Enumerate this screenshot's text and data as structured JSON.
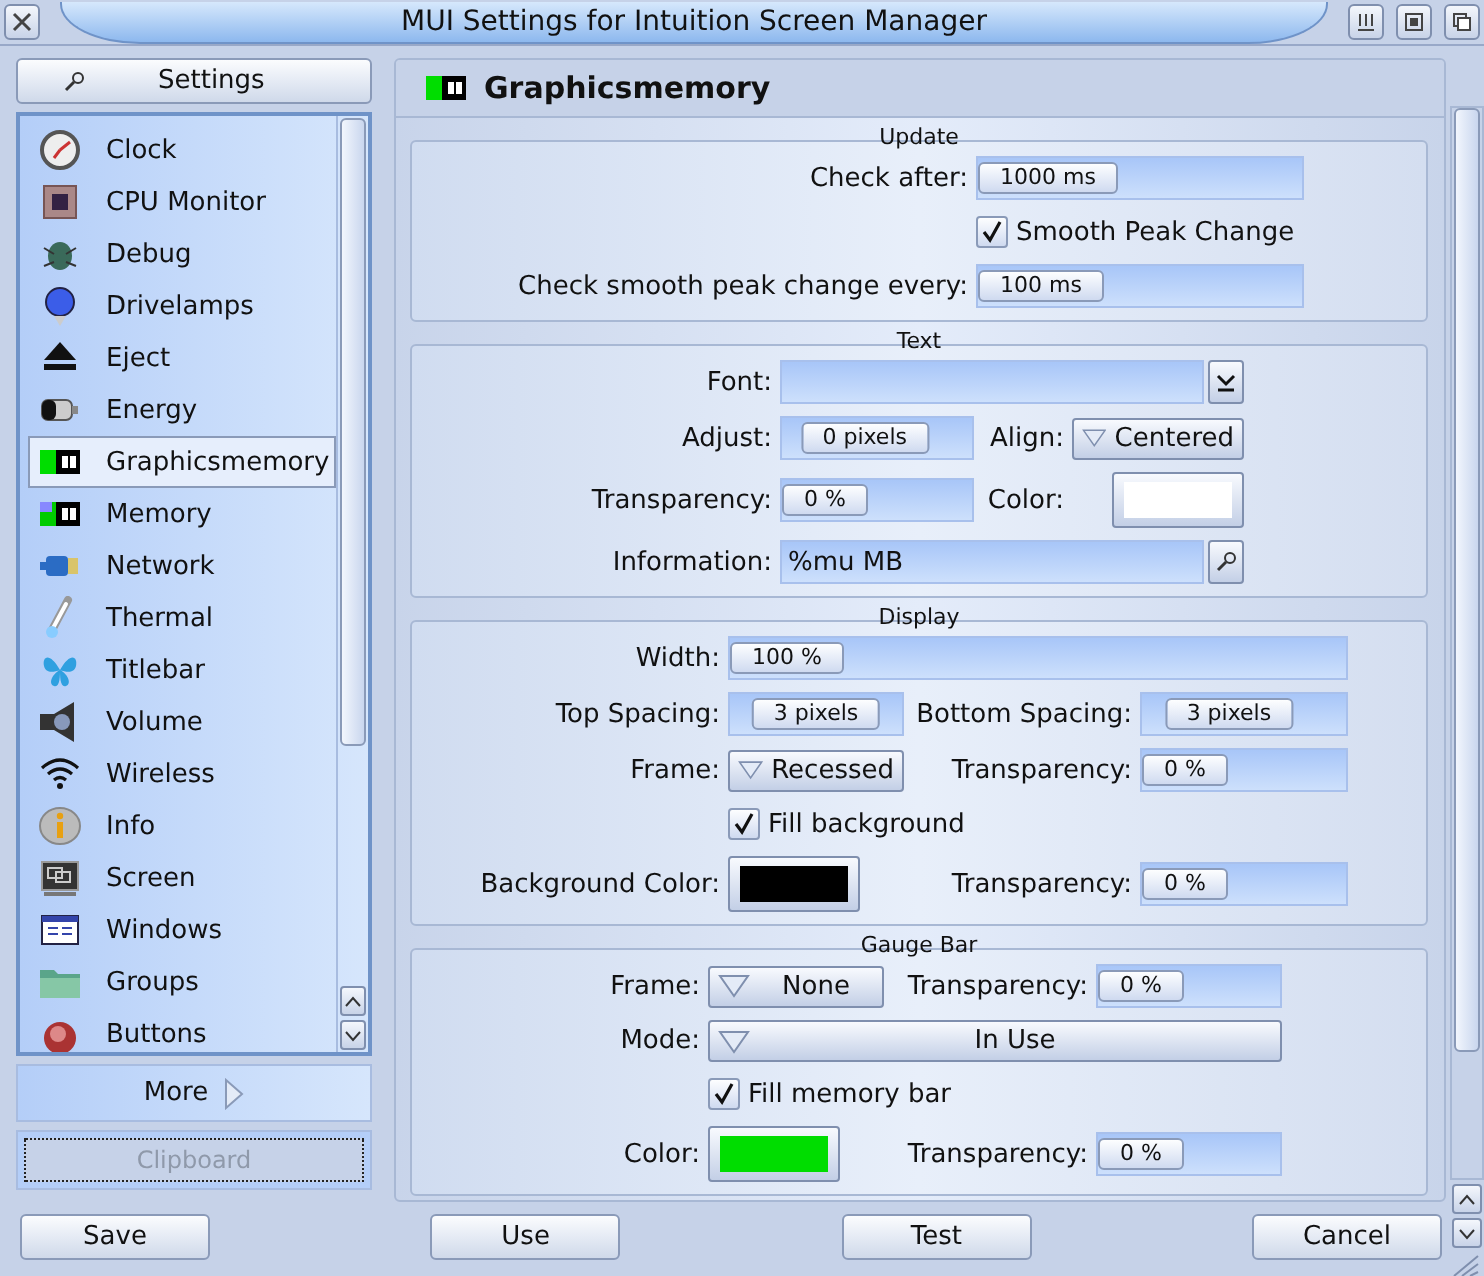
{
  "window": {
    "title": "MUI Settings for Intuition Screen Manager"
  },
  "sidebar": {
    "settings_button": "Settings",
    "items": [
      {
        "label": "Clock",
        "selected": false
      },
      {
        "label": "CPU Monitor",
        "selected": false
      },
      {
        "label": "Debug",
        "selected": false
      },
      {
        "label": "Drivelamps",
        "selected": false
      },
      {
        "label": "Eject",
        "selected": false
      },
      {
        "label": "Energy",
        "selected": false
      },
      {
        "label": "Graphicsmemory",
        "selected": true
      },
      {
        "label": "Memory",
        "selected": false
      },
      {
        "label": "Network",
        "selected": false
      },
      {
        "label": "Thermal",
        "selected": false
      },
      {
        "label": "Titlebar",
        "selected": false
      },
      {
        "label": "Volume",
        "selected": false
      },
      {
        "label": "Wireless",
        "selected": false
      },
      {
        "label": "Info",
        "selected": false
      },
      {
        "label": "Screen",
        "selected": false
      },
      {
        "label": "Windows",
        "selected": false
      },
      {
        "label": "Groups",
        "selected": false
      },
      {
        "label": "Buttons",
        "selected": false
      }
    ],
    "more_button": "More",
    "clipboard_button": {
      "label": "Clipboard",
      "disabled": true
    }
  },
  "panel": {
    "title": "Graphicsmemory",
    "groups": [
      {
        "title": "Update",
        "rows": [
          [
            {
              "kind": "slider",
              "label": "Check after:",
              "value": "1000 ms",
              "level": 0
            }
          ],
          [
            {
              "kind": "checkbox",
              "label": "Smooth Peak Change",
              "checked": true
            }
          ],
          [
            {
              "kind": "slider",
              "label": "Check smooth peak change every:",
              "value": "100 ms",
              "level": 0
            }
          ]
        ]
      },
      {
        "title": "Text",
        "rows": [
          [
            {
              "kind": "fontfield",
              "label": "Font:"
            }
          ],
          [
            {
              "kind": "slider",
              "label": "Adjust:",
              "value": "0 pixels",
              "level": 0.3
            },
            {
              "kind": "cycle",
              "label": "Align:",
              "value": "Centered"
            }
          ],
          [
            {
              "kind": "slider",
              "label": "Transparency:",
              "value": "0 %",
              "level": 0
            },
            {
              "kind": "color",
              "label": "Color:",
              "color": "#ffffff"
            }
          ],
          [
            {
              "kind": "searchfield",
              "label": "Information:",
              "value": "%mu MB"
            }
          ]
        ]
      },
      {
        "title": "Display",
        "rows": [
          [
            {
              "kind": "slider",
              "label": "Width:",
              "value": "100 %",
              "level": 0
            }
          ],
          [
            {
              "kind": "slider",
              "label": "Top Spacing:",
              "value": "3 pixels",
              "level": 0.5
            },
            {
              "kind": "slider",
              "label": "Bottom Spacing:",
              "value": "3 pixels",
              "level": 0.3
            }
          ],
          [
            {
              "kind": "cycle",
              "label": "Frame:",
              "value": "Recessed"
            },
            {
              "kind": "slider",
              "label": "Transparency:",
              "value": "0 %",
              "level": 0
            }
          ],
          [
            {
              "kind": "checkbox",
              "label": "Fill background",
              "checked": true
            }
          ],
          [
            {
              "kind": "color",
              "label": "Background Color:",
              "color": "#000000"
            },
            {
              "kind": "slider",
              "label": "Transparency:",
              "value": "0 %",
              "level": 0
            }
          ]
        ]
      },
      {
        "title": "Gauge Bar",
        "rows": [
          [
            {
              "kind": "cycle",
              "label": "Frame:",
              "value": "None"
            },
            {
              "kind": "slider",
              "label": "Transparency:",
              "value": "0 %",
              "level": 0
            }
          ],
          [
            {
              "kind": "cycle",
              "label": "Mode:",
              "value": "In Use"
            }
          ],
          [
            {
              "kind": "checkbox",
              "label": "Fill memory bar",
              "checked": true
            }
          ],
          [
            {
              "kind": "color",
              "label": "Color:",
              "color": "#00dd00"
            },
            {
              "kind": "slider",
              "label": "Transparency:",
              "value": "0 %",
              "level": 0
            }
          ]
        ]
      }
    ]
  },
  "buttons": [
    "Save",
    "Use",
    "Test",
    "Cancel"
  ]
}
